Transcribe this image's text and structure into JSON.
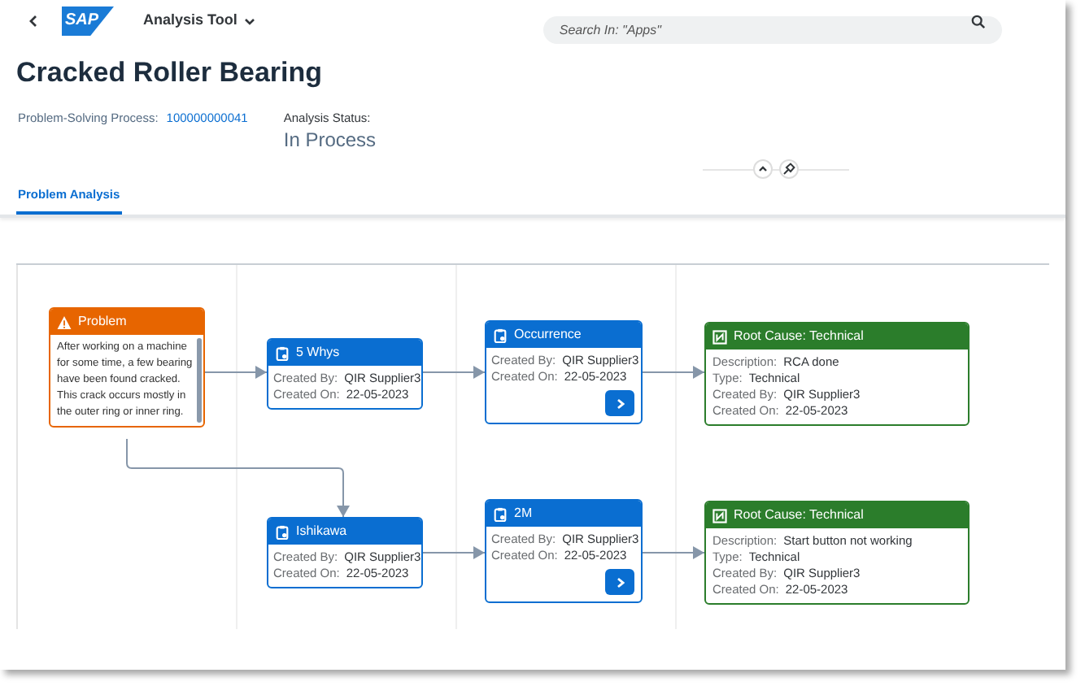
{
  "shell": {
    "logo": "SAP",
    "app_title": "Analysis Tool",
    "search": {
      "placeholder": "Search In: \"Apps\""
    }
  },
  "header": {
    "title": "Cracked Roller Bearing",
    "process_label": "Problem-Solving Process:",
    "process_value": "100000000041",
    "status_label": "Analysis Status:",
    "status_value": "In Process"
  },
  "tabs": [
    {
      "label": "Problem Analysis",
      "selected": true
    }
  ],
  "diagram": {
    "nodes": [
      {
        "kind": "problem",
        "title": "Problem",
        "text": "After working on a machine for some time, a few bearing have been found cracked. This crack occurs mostly in the outer ring or inner ring."
      },
      {
        "kind": "method",
        "title": "5 Whys",
        "rows": [
          {
            "label": "Created By:",
            "value": "QIR Supplier3"
          },
          {
            "label": "Created On:",
            "value": "22-05-2023"
          }
        ],
        "has_nav_button": false
      },
      {
        "kind": "method",
        "title": "Occurrence",
        "rows": [
          {
            "label": "Created By:",
            "value": "QIR Supplier3"
          },
          {
            "label": "Created On:",
            "value": "22-05-2023"
          }
        ],
        "has_nav_button": true
      },
      {
        "kind": "root_cause",
        "title": "Root Cause: Technical",
        "rows": [
          {
            "label": "Description:",
            "value": "RCA done"
          },
          {
            "label": "Type:",
            "value": "Technical"
          },
          {
            "label": "Created By:",
            "value": "QIR Supplier3"
          },
          {
            "label": "Created On:",
            "value": "22-05-2023"
          }
        ]
      },
      {
        "kind": "method",
        "title": "Ishikawa",
        "rows": [
          {
            "label": "Created By:",
            "value": "QIR Supplier3"
          },
          {
            "label": "Created On:",
            "value": "22-05-2023"
          }
        ],
        "has_nav_button": false
      },
      {
        "kind": "method",
        "title": "2M",
        "rows": [
          {
            "label": "Created By:",
            "value": "QIR Supplier3"
          },
          {
            "label": "Created On:",
            "value": "22-05-2023"
          }
        ],
        "has_nav_button": true
      },
      {
        "kind": "root_cause",
        "title": "Root Cause: Technical",
        "rows": [
          {
            "label": "Description:",
            "value": "Start button not working"
          },
          {
            "label": "Type:",
            "value": "Technical"
          },
          {
            "label": "Created By:",
            "value": "QIR Supplier3"
          },
          {
            "label": "Created On:",
            "value": "22-05-2023"
          }
        ]
      }
    ]
  }
}
